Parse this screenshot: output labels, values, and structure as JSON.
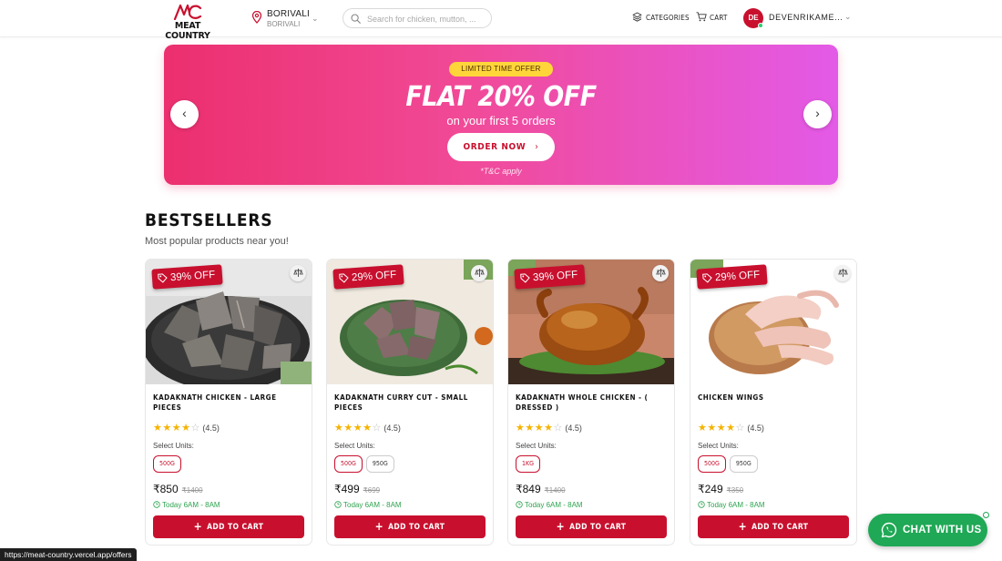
{
  "header": {
    "logo_text": "MEAT COUNTRY",
    "location_city": "BORIVALI",
    "location_sub": "BORIVALI",
    "search_placeholder": "Search for chicken, mutton, ...",
    "categories_label": "CATEGORIES",
    "cart_label": "CART",
    "avatar_initials": "DE",
    "username": "DEVENRIKAME..."
  },
  "banner": {
    "pill": "LIMITED TIME OFFER",
    "title": "FLAT 20% OFF",
    "subtitle": "on your first 5 orders",
    "cta": "ORDER NOW",
    "footnote": "*T&C apply",
    "colors": {
      "start": "#ec2f6e",
      "end": "#e35ae7",
      "pill": "#ffd63a"
    }
  },
  "bestsellers": {
    "title": "BESTSELLERS",
    "subtitle": "Most popular products near you!",
    "products": [
      {
        "name": "KADAKNATH CHICKEN - LARGE PIECES",
        "discount": "39% OFF",
        "rating": "(4.5)",
        "units_label": "Select Units:",
        "units": [
          "500G"
        ],
        "price": "₹850",
        "mrp": "₹1400",
        "delivery": "Today 6AM - 8AM",
        "cta": "ADD TO CART"
      },
      {
        "name": "KADAKNATH CURRY CUT - SMALL PIECES",
        "discount": "29% OFF",
        "rating": "(4.5)",
        "units_label": "Select Units:",
        "units": [
          "500G",
          "950G"
        ],
        "price": "₹499",
        "mrp": "₹699",
        "delivery": "Today 6AM - 8AM",
        "cta": "ADD TO CART"
      },
      {
        "name": "KADAKNATH WHOLE CHICKEN - ( DRESSED )",
        "discount": "39% OFF",
        "rating": "(4.5)",
        "units_label": "Select Units:",
        "units": [
          "1KG"
        ],
        "price": "₹849",
        "mrp": "₹1400",
        "delivery": "Today 6AM - 8AM",
        "cta": "ADD TO CART"
      },
      {
        "name": "CHICKEN WINGS",
        "discount": "29% OFF",
        "rating": "(4.5)",
        "units_label": "Select Units:",
        "units": [
          "500G",
          "950G"
        ],
        "price": "₹249",
        "mrp": "₹350",
        "delivery": "Today 6AM - 8AM",
        "cta": "ADD TO CART"
      }
    ]
  },
  "chat": {
    "label": "CHAT WITH US"
  },
  "status_bar": {
    "url": "https://meat-country.vercel.app/offers"
  },
  "theme": {
    "accent": "#c8102e",
    "whatsapp": "#1fa855",
    "star": "#f5b301"
  }
}
